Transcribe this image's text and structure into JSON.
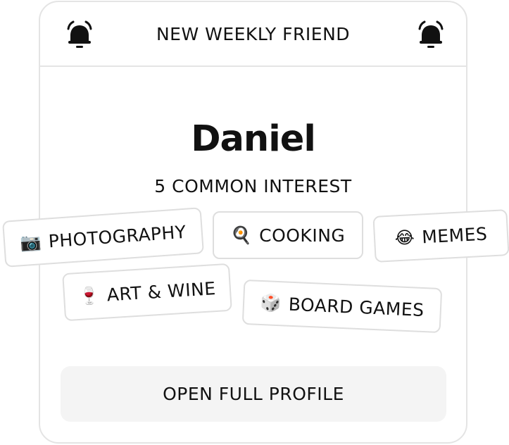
{
  "header": {
    "title": "NEW WEEKLY FRIEND",
    "left_icon": "alarm-bell-icon",
    "right_icon": "alarm-bell-icon"
  },
  "profile": {
    "name": "Daniel",
    "common_interest_label": "5 COMMON INTEREST"
  },
  "interests": [
    {
      "emoji": "📷",
      "label": "PHOTOGRAPHY"
    },
    {
      "emoji": "🍳",
      "label": "COOKING"
    },
    {
      "emoji": "😂",
      "label": "MEMES"
    },
    {
      "emoji": "🍷",
      "label": "ART & WINE"
    },
    {
      "emoji": "🎲",
      "label": "BOARD GAMES"
    }
  ],
  "actions": {
    "open_profile_label": "OPEN FULL PROFILE"
  },
  "colors": {
    "border": "#e4e4e4",
    "button_bg": "#f4f4f4",
    "text": "#111111"
  }
}
